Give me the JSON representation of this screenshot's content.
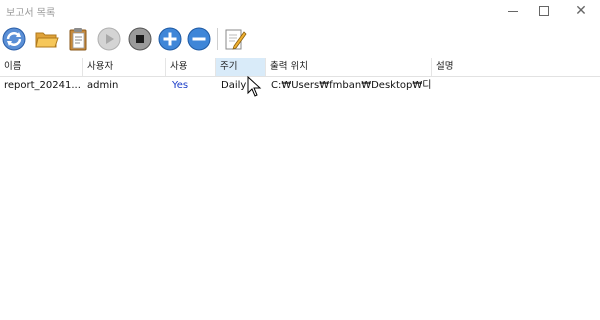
{
  "window": {
    "title": "보고서 목록"
  },
  "toolbar": {
    "buttons": [
      {
        "name": "refresh-button",
        "icon": "refresh-icon"
      },
      {
        "name": "open-folder-button",
        "icon": "folder-open-icon"
      },
      {
        "name": "clipboard-button",
        "icon": "clipboard-icon"
      },
      {
        "name": "run-button",
        "icon": "play-icon"
      },
      {
        "name": "stop-button",
        "icon": "stop-icon"
      },
      {
        "name": "add-button",
        "icon": "plus-icon"
      },
      {
        "name": "remove-button",
        "icon": "minus-icon"
      },
      {
        "name": "edit-button",
        "icon": "edit-icon"
      }
    ]
  },
  "list": {
    "columns": [
      "이름",
      "사용자",
      "사용",
      "주기",
      "출력 위치",
      "설명"
    ],
    "rows": [
      {
        "name": "report_20241...",
        "user": "admin",
        "enabled": "Yes",
        "period": "Daily",
        "output": "C:₩Users₩fmban₩Desktop₩디...",
        "description": ""
      }
    ]
  },
  "colors": {
    "header_sorted_bg": "#d9ebf9",
    "enabled_text": "#1a3cc8",
    "title_text": "#9a9a9a"
  }
}
